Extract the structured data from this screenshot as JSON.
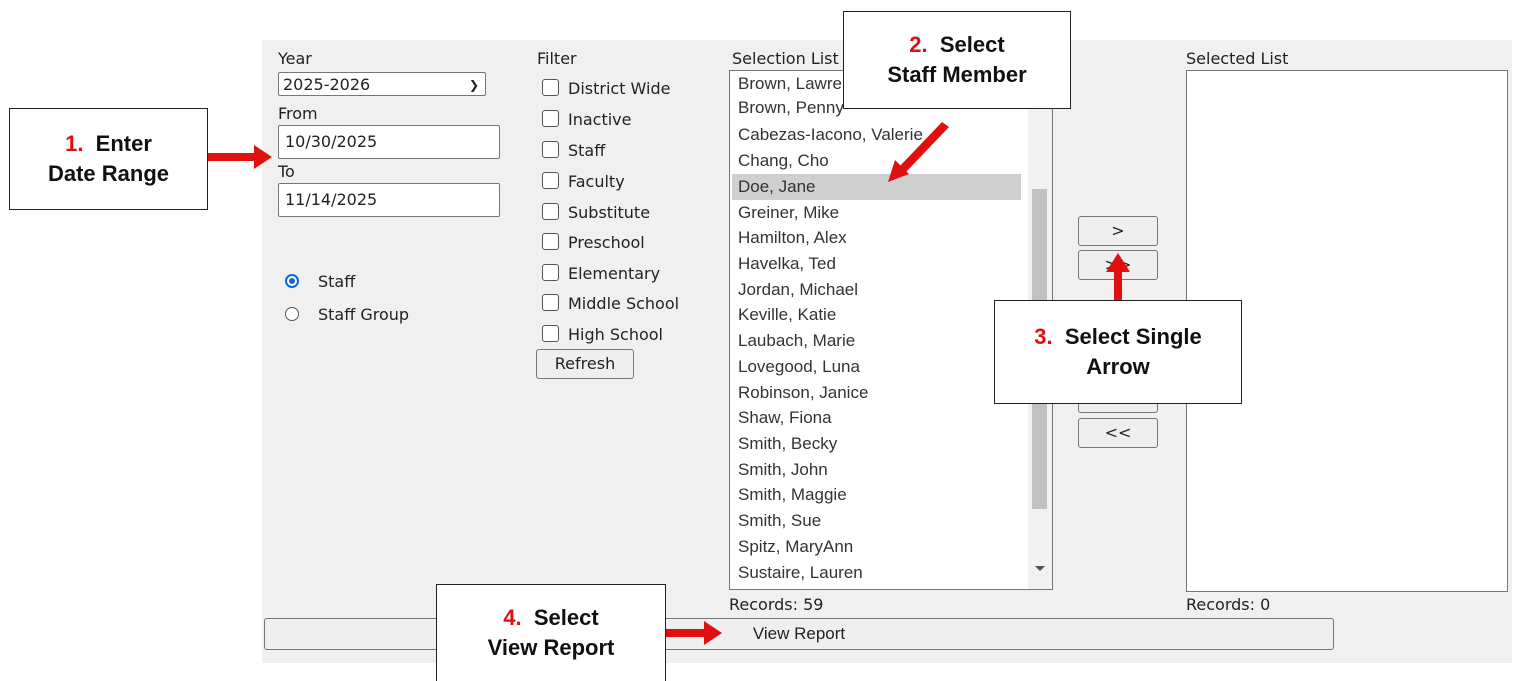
{
  "year": {
    "label": "Year",
    "value": "2025-2026"
  },
  "from": {
    "label": "From",
    "value": "10/30/2025"
  },
  "to": {
    "label": "To",
    "value": "11/14/2025"
  },
  "radios": [
    {
      "label": "Staff",
      "checked": true
    },
    {
      "label": "Staff Group",
      "checked": false
    }
  ],
  "filter": {
    "label": "Filter",
    "options": [
      "District Wide",
      "Inactive",
      "Staff",
      "Faculty",
      "Substitute",
      "Preschool",
      "Elementary",
      "Middle School",
      "High School"
    ],
    "refresh_label": "Refresh"
  },
  "selection_list": {
    "label": "Selection List",
    "selected": "Doe, Jane",
    "items": [
      "Brown, Lawrence",
      "Brown, Penny",
      "Cabezas-Iacono, Valerie",
      "Chang, Cho",
      "Doe, Jane",
      "Greiner, Mike",
      "Hamilton, Alex",
      "Havelka, Ted",
      "Jordan, Michael",
      "Keville, Katie",
      "Laubach, Marie",
      "Lovegood, Luna",
      "Robinson, Janice",
      "Shaw, Fiona",
      "Smith, Becky",
      "Smith, John",
      "Smith, Maggie",
      "Smith, Sue",
      "Spitz, MaryAnn",
      "Sustaire, Lauren"
    ],
    "records": "Records: 59"
  },
  "move_buttons": {
    "single_right": ">",
    "all_right": ">>",
    "all_left": "<<"
  },
  "selected_list": {
    "label": "Selected List",
    "records": "Records: 0"
  },
  "view_report_label": "View Report",
  "callouts": {
    "c1": {
      "num": "1.",
      "line1": "Enter",
      "line2": "Date Range"
    },
    "c2": {
      "num": "2.",
      "line1": "Select",
      "line2": "Staff Member"
    },
    "c3": {
      "num": "3.",
      "line1": "Select Single",
      "line2": "Arrow"
    },
    "c4": {
      "num": "4.",
      "line1": "Select",
      "line2": "View Report"
    }
  },
  "colors": {
    "panel": "#f0f0f0",
    "radio_accent": "#0b66d6",
    "callout_number": "#e01010",
    "arrow": "#e01010"
  }
}
